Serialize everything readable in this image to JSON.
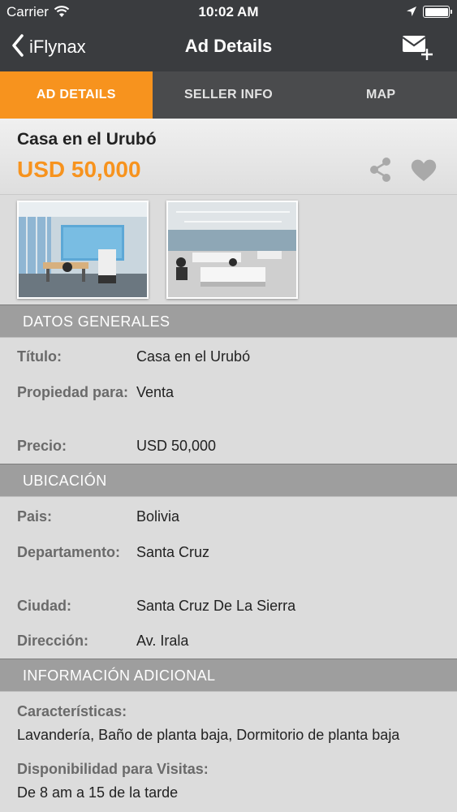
{
  "status_bar": {
    "carrier": "Carrier",
    "time": "10:02 AM"
  },
  "nav": {
    "back_label": "iFlynax",
    "title": "Ad Details"
  },
  "tabs": [
    {
      "label": "AD DETAILS",
      "active": true
    },
    {
      "label": "SELLER INFO",
      "active": false
    },
    {
      "label": "MAP",
      "active": false
    }
  ],
  "ad": {
    "title": "Casa en el Urubó",
    "price": "USD 50,000"
  },
  "sections": {
    "general": {
      "header": "DATOS GENERALES",
      "rows": [
        {
          "label": "Título:",
          "value": "Casa en el Urubó"
        },
        {
          "label": "Propiedad para:",
          "value": "Venta"
        },
        {
          "label": "Precio:",
          "value": "USD 50,000"
        }
      ]
    },
    "location": {
      "header": "UBICACIÓN",
      "rows": [
        {
          "label": "Pais:",
          "value": "Bolivia"
        },
        {
          "label": "Departamento:",
          "value": "Santa Cruz"
        },
        {
          "label": "Ciudad:",
          "value": "Santa Cruz De La Sierra"
        },
        {
          "label": "Dirección:",
          "value": "Av. Irala"
        }
      ]
    },
    "additional": {
      "header": "INFORMACIÓN ADICIONAL",
      "rows": [
        {
          "label": "Características:",
          "value": "Lavandería, Baño de planta baja, Dormitorio de planta baja"
        },
        {
          "label": "Disponibilidad para Visitas:",
          "value": "De 8 am a 15 de la tarde"
        }
      ]
    }
  },
  "icons": {
    "back": "chevron-left-icon",
    "compose_mail": "mail-plus-icon",
    "share": "share-icon",
    "favorite": "heart-icon"
  },
  "colors": {
    "accent": "#f7931e",
    "nav_bg": "#3a3c3f",
    "tab_bg": "#4a4b4d",
    "section_bg": "#9e9e9e"
  }
}
